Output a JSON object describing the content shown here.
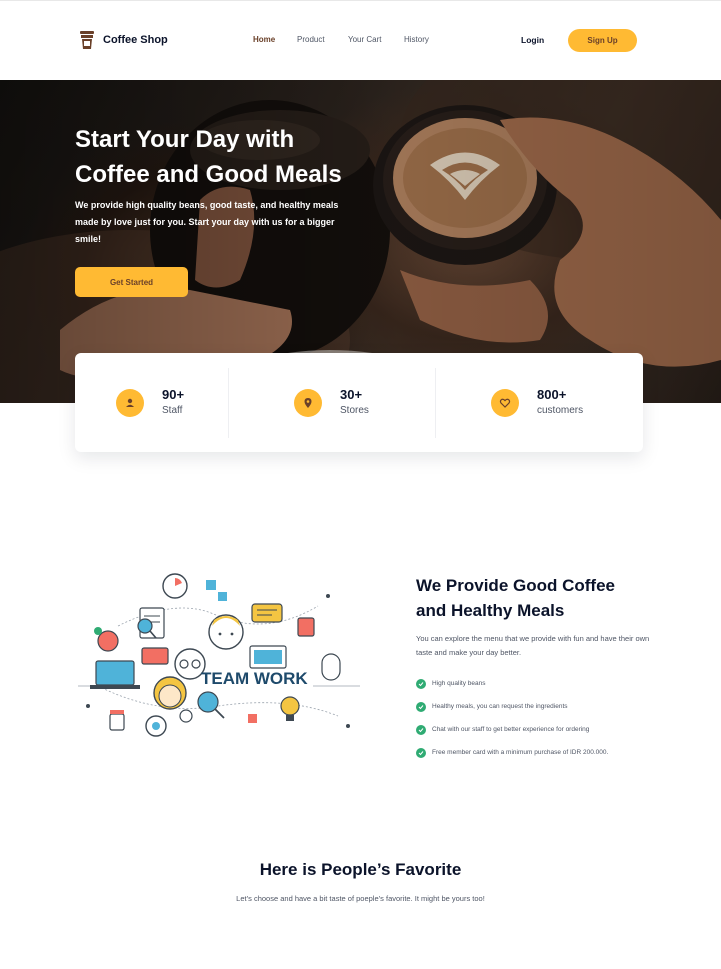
{
  "nav": {
    "brand": "Coffee Shop",
    "brand_icon": "coffee-cup-icon",
    "links": [
      {
        "label": "Home",
        "active": true
      },
      {
        "label": "Product",
        "active": false
      },
      {
        "label": "Your Cart",
        "active": false
      },
      {
        "label": "History",
        "active": false
      }
    ],
    "login_label": "Login",
    "signup_label": "Sign Up"
  },
  "hero": {
    "title": "Start Your Day with Coffee and Good Meals",
    "subtitle": "We provide high quality beans, good taste, and healthy meals made by love just for you. Start your day with us for a bigger smile!",
    "cta_label": "Get Started"
  },
  "stats": [
    {
      "value": "90+",
      "label": "Staff",
      "icon": "user-icon"
    },
    {
      "value": "30+",
      "label": "Stores",
      "icon": "location-pin-icon"
    },
    {
      "value": "800+",
      "label": "customers",
      "icon": "heart-icon"
    }
  ],
  "feature": {
    "illustration_text": "TEAM WORK",
    "title": "We Provide Good Coffee and Healthy Meals",
    "description": "You can explore the menu that we provide with fun and have their own taste and make your day better.",
    "items": [
      "High quality beans",
      "Healthy meals, you can request the ingredients",
      "Chat with our staff to get better experience for ordering",
      "Free member card with a minimum purchase of IDR 200.000."
    ]
  },
  "favorite": {
    "title": "Here is People’s Favorite",
    "subtitle": "Let’s choose and have a bit taste of poeple’s favorite. It might be yours too!"
  },
  "colors": {
    "accent": "#ffba33",
    "brand_brown": "#6a4029",
    "check_green": "#2fab73",
    "dark_text": "#0b132a",
    "muted_text": "#4f5665"
  }
}
